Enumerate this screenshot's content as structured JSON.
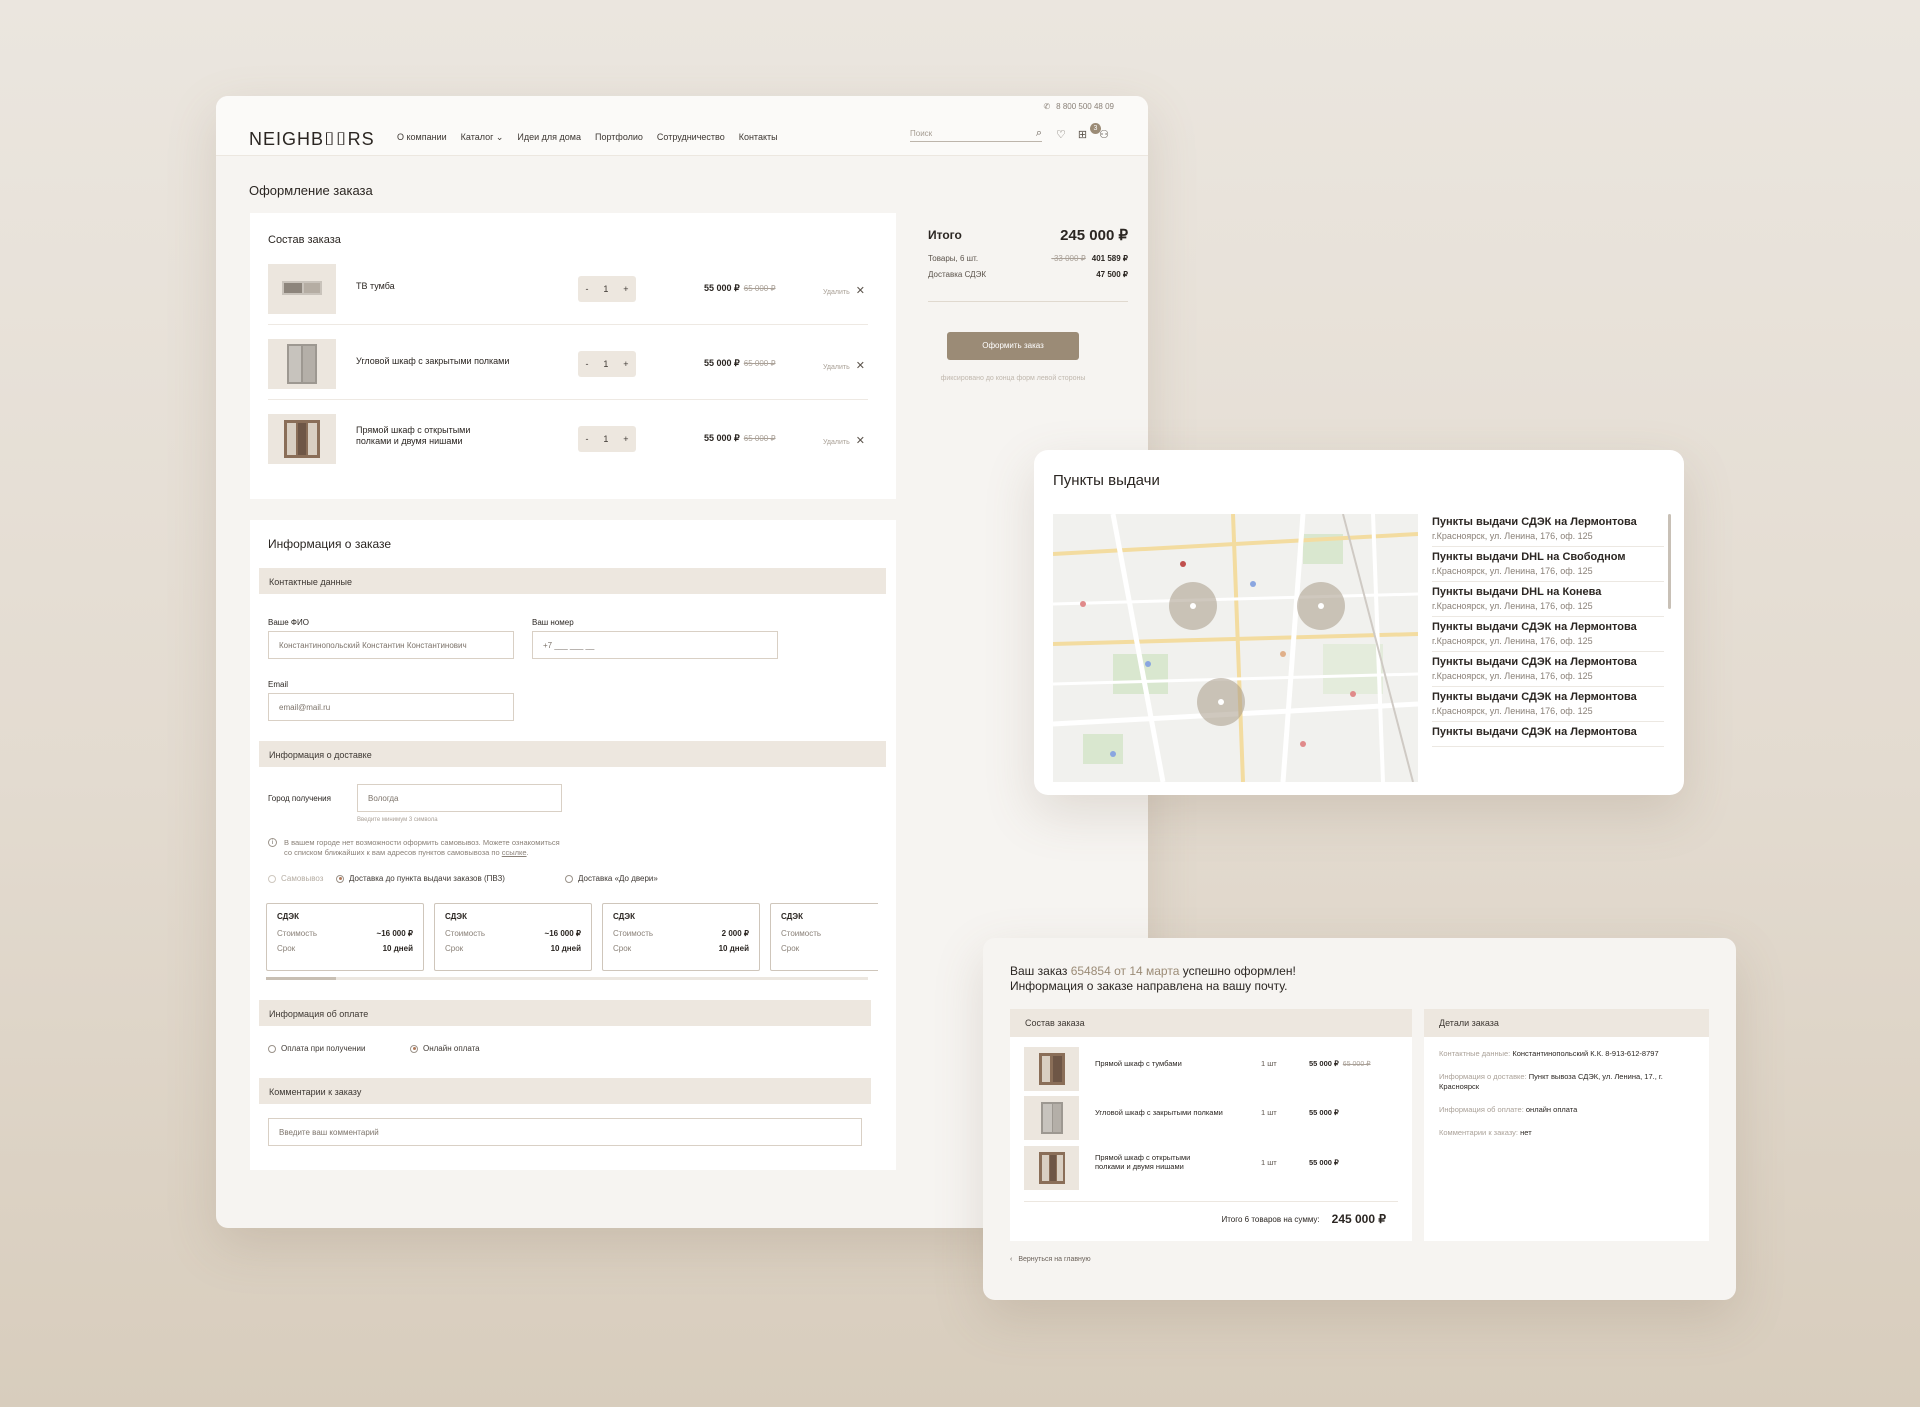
{
  "checkout": {
    "phone": "8 800 500 48 09",
    "logo": "NEIGHB⌷⌷RS",
    "nav": [
      "О компании",
      "Каталог",
      "Идеи для дома",
      "Портфолио",
      "Сотрудничество",
      "Контакты"
    ],
    "search_placeholder": "Поиск",
    "cart_count": "3",
    "page_title": "Оформление заказа",
    "order": {
      "title": "Состав заказа",
      "items": [
        {
          "name": "ТВ тумба",
          "qty": "1",
          "price": "55 000 ₽",
          "old": "65 000 ₽",
          "delete": "Удалить"
        },
        {
          "name": "Угловой шкаф с закрытыми полками",
          "qty": "1",
          "price": "55 000 ₽",
          "old": "65 000 ₽",
          "delete": "Удалить"
        },
        {
          "name": "Прямой шкаф с  открытыми полками и двумя нишами",
          "qty": "1",
          "price": "55 000 ₽",
          "old": "65 000 ₽",
          "delete": "Удалить"
        }
      ],
      "minus": "-",
      "plus": "+"
    },
    "summary": {
      "total_label": "Итого",
      "total": "245 000 ₽",
      "goods_label": "Товары, 6 шт.",
      "goods_old": "-33 000 ₽",
      "goods_price": "401 589 ₽",
      "delivery_label": "Доставка СДЭК",
      "delivery_price": "47 500 ₽",
      "button": "Оформить заказ",
      "hint": "фиксировано до конца форм левой стороны"
    },
    "info": {
      "title": "Информация о заказе",
      "contacts_bar": "Контактные данные",
      "fio_label": "Ваше ФИО",
      "fio_value": "Константинопольский Константин Константинович",
      "phone_label": "Ваш номер",
      "phone_value": "+7 ___ ___ __",
      "email_label": "Email",
      "email_value": "email@mail.ru",
      "delivery_bar": "Информация о доставке",
      "city_label": "Город получения",
      "city_value": "Вологда",
      "city_hint": "Введите минимум 3 символа",
      "notice_1": "В вашем городе нет возможности оформить самовывоз. Можете ознакомиться",
      "notice_2": "со списком ближайших к вам адресов  пунктов самовывоза по ",
      "notice_link": "ссылке",
      "notice_end": ".",
      "radio_pickup": "Самовывоз",
      "radio_pvz": "Доставка до пункта выдачи заказов (ПВЗ)",
      "radio_door": "Доставка «До двери»",
      "dcards": [
        {
          "title": "СДЭК",
          "cost_label": "Стоимость",
          "cost": "~16 000 ₽",
          "term_label": "Срок",
          "term": "10 дней"
        },
        {
          "title": "СДЭК",
          "cost_label": "Стоимость",
          "cost": "~16 000 ₽",
          "term_label": "Срок",
          "term": "10 дней"
        },
        {
          "title": "СДЭК",
          "cost_label": "Стоимость",
          "cost": "2 000 ₽",
          "term_label": "Срок",
          "term": "10 дней"
        },
        {
          "title": "СДЭК",
          "cost_label": "Стоимость",
          "cost": "",
          "term_label": "Срок",
          "term": ""
        }
      ],
      "payment_bar": "Информация об оплате",
      "pay_cash": "Оплата при получении",
      "pay_online": "Онлайн оплата",
      "comment_bar": "Комментарии к заказу",
      "comment_placeholder": "Введите ваш комментарий"
    }
  },
  "pickup": {
    "title": "Пункты выдачи",
    "points": [
      {
        "name": "Пункты выдачи СДЭК на Лермонтова",
        "address": "г.Красноярск, ул. Ленина, 176, оф. 125"
      },
      {
        "name": "Пункты выдачи DHL на Свободном",
        "address": "г.Красноярск, ул. Ленина, 176, оф. 125"
      },
      {
        "name": "Пункты выдачи DHL на Конева",
        "address": "г.Красноярск, ул. Ленина, 176, оф. 125"
      },
      {
        "name": "Пункты выдачи СДЭК на Лермонтова",
        "address": "г.Красноярск, ул. Ленина, 176, оф. 125"
      },
      {
        "name": "Пункты выдачи СДЭК на Лермонтова",
        "address": "г.Красноярск, ул. Ленина, 176, оф. 125"
      },
      {
        "name": "Пункты выдачи СДЭК на Лермонтова",
        "address": "г.Красноярск, ул. Ленина, 176, оф. 125"
      },
      {
        "name": "Пункты выдачи СДЭК на Лермонтова",
        "address": ""
      }
    ]
  },
  "success": {
    "msg_pre": "Ваш заказ ",
    "order_no": "654854 от 14 марта",
    "msg_post": " успешно оформлен!",
    "msg_line2": "Информация о заказе направлена на вашу почту.",
    "order_head": "Состав заказа",
    "details_head": "Детали заказа",
    "items": [
      {
        "name": "Прямой шкаф с тумбами",
        "qty": "1 шт",
        "price": "55 000 ₽",
        "old": "65 000 ₽"
      },
      {
        "name": "Угловой шкаф с закрытыми полками",
        "qty": "1 шт",
        "price": "55 000 ₽",
        "old": ""
      },
      {
        "name": "Прямой шкаф с  открытыми полками и двумя нишами",
        "qty": "1 шт",
        "price": "55 000 ₽",
        "old": ""
      }
    ],
    "total_label": "Итого 6 товаров на сумму:",
    "total": "245 000 ₽",
    "details": {
      "contacts_label": "Контактные данные:",
      "contacts": "Константинопольский К.К. 8-913-612-8797",
      "delivery_label": "Информация о доставке:",
      "delivery": "Пункт вывоза СДЭК, ул. Ленина, 17., г. Красноярск",
      "payment_label": "Информация об оплате:",
      "payment": "онлайн оплата",
      "comment_label": "Комментарии к заказу:",
      "comment": "нет"
    },
    "back": "Вернуться на главную"
  }
}
